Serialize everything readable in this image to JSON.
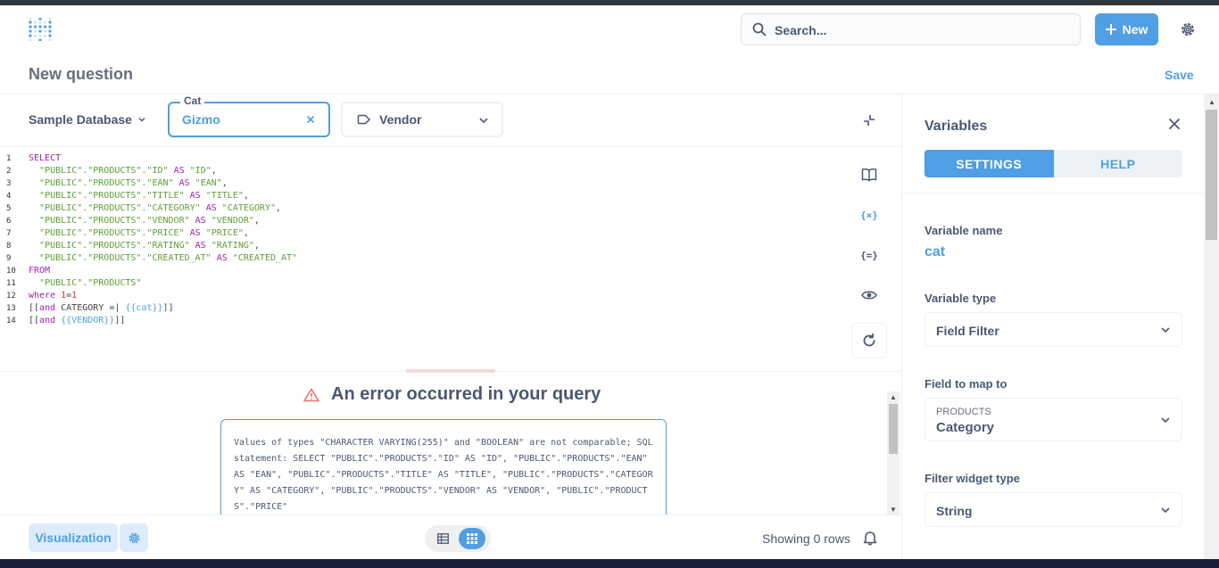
{
  "nav": {
    "search_placeholder": "Search...",
    "new_label": "New"
  },
  "header": {
    "title": "New question",
    "save_label": "Save"
  },
  "toolbar": {
    "database": "Sample Database",
    "cat_filter": {
      "label": "Cat",
      "value": "Gizmo"
    },
    "vendor_filter": {
      "value": "Vendor"
    }
  },
  "editor": {
    "lines": [
      {
        "n": "1",
        "html": "<span class=\"kw\">SELECT</span>"
      },
      {
        "n": "2",
        "html": "  <span class=\"str\">\"PUBLIC\".\"PRODUCTS\".\"ID\"</span> <span class=\"kw\">AS</span> <span class=\"str\">\"ID\"</span>,"
      },
      {
        "n": "3",
        "html": "  <span class=\"str\">\"PUBLIC\".\"PRODUCTS\".\"EAN\"</span> <span class=\"kw\">AS</span> <span class=\"str\">\"EAN\"</span>,"
      },
      {
        "n": "4",
        "html": "  <span class=\"str\">\"PUBLIC\".\"PRODUCTS\".\"TITLE\"</span> <span class=\"kw\">AS</span> <span class=\"str\">\"TITLE\"</span>,"
      },
      {
        "n": "5",
        "html": "  <span class=\"str\">\"PUBLIC\".\"PRODUCTS\".\"CATEGORY\"</span> <span class=\"kw\">AS</span> <span class=\"str\">\"CATEGORY\"</span>,"
      },
      {
        "n": "6",
        "html": "  <span class=\"str\">\"PUBLIC\".\"PRODUCTS\".\"VENDOR\"</span> <span class=\"kw\">AS</span> <span class=\"str\">\"VENDOR\"</span>,"
      },
      {
        "n": "7",
        "html": "  <span class=\"str\">\"PUBLIC\".\"PRODUCTS\".\"PRICE\"</span> <span class=\"kw\">AS</span> <span class=\"str\">\"PRICE\"</span>,"
      },
      {
        "n": "8",
        "html": "  <span class=\"str\">\"PUBLIC\".\"PRODUCTS\".\"RATING\"</span> <span class=\"kw\">AS</span> <span class=\"str\">\"RATING\"</span>,"
      },
      {
        "n": "9",
        "html": "  <span class=\"str\">\"PUBLIC\".\"PRODUCTS\".\"CREATED_AT\"</span> <span class=\"kw\">AS</span> <span class=\"str\">\"CREATED_AT\"</span>"
      },
      {
        "n": "10",
        "html": "<span class=\"kw\">FROM</span>"
      },
      {
        "n": "11",
        "html": "  <span class=\"str\">\"PUBLIC\".\"PRODUCTS\"</span>"
      },
      {
        "n": "12",
        "html": "<span class=\"kw\">where</span> <span class=\"num\">1</span>=<span class=\"num\">1</span>"
      },
      {
        "n": "13",
        "html": "[[<span class=\"kw\">and</span> CATEGORY =| <span class=\"var\">{{cat}}</span>]]"
      },
      {
        "n": "14",
        "html": "[[<span class=\"kw\">and</span> <span class=\"var\">{{VENDOR}}</span>]]"
      }
    ]
  },
  "results": {
    "error_title": "An error occurred in your query",
    "error_message": "Values of types \"CHARACTER VARYING(255)\" and \"BOOLEAN\" are not comparable; SQL statement: SELECT \"PUBLIC\".\"PRODUCTS\".\"ID\" AS \"ID\", \"PUBLIC\".\"PRODUCTS\".\"EAN\" AS \"EAN\", \"PUBLIC\".\"PRODUCTS\".\"TITLE\" AS \"TITLE\", \"PUBLIC\".\"PRODUCTS\".\"CATEGORY\" AS \"CATEGORY\", \"PUBLIC\".\"PRODUCTS\".\"VENDOR\" AS \"VENDOR\", \"PUBLIC\".\"PRODUCTS\".\"PRICE\""
  },
  "footer": {
    "visualization_label": "Visualization",
    "row_count": "Showing 0 rows"
  },
  "sidebar": {
    "title": "Variables",
    "tabs": {
      "settings": "SETTINGS",
      "help": "HELP"
    },
    "variable_name_label": "Variable name",
    "variable_name": "cat",
    "variable_type_label": "Variable type",
    "variable_type": "Field Filter",
    "field_map_label": "Field to map to",
    "field_map_table": "PRODUCTS",
    "field_map_field": "Category",
    "widget_type_label": "Filter widget type",
    "widget_type": "String"
  },
  "colors": {
    "brand": "#509ee3",
    "text": "#4c5773",
    "error": "#ed6e6e"
  }
}
